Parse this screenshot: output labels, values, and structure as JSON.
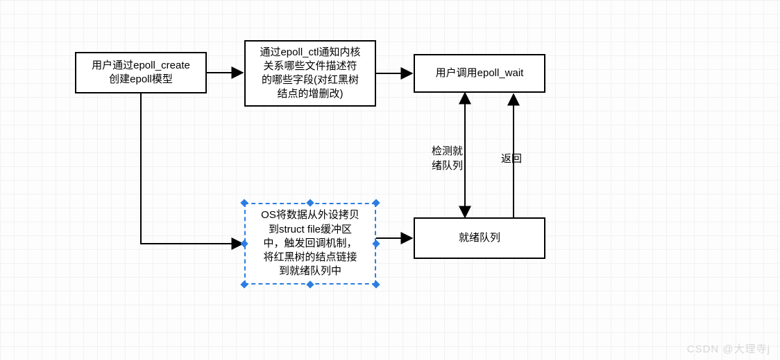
{
  "nodes": {
    "create": "用户通过epoll_create\n创建epoll模型",
    "ctl": "通过epoll_ctl通知内核\n关系哪些文件描述符\n的哪些字段(对红黑树\n结点的增删改)",
    "wait": "用户调用epoll_wait",
    "callback": "OS将数据从外设拷贝\n到struct file缓冲区\n中，触发回调机制，\n将红黑树的结点链接\n到就绪队列中",
    "ready": "就绪队列"
  },
  "labels": {
    "check": "检测就\n绪队列",
    "return": "返回"
  },
  "watermark": "CSDN @大理寺j"
}
